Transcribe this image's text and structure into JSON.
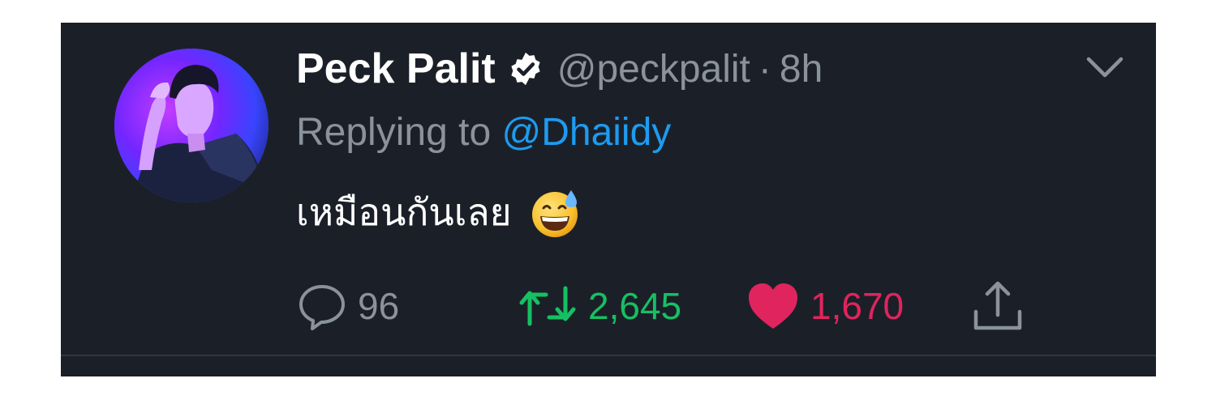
{
  "tweet": {
    "author": {
      "display_name": "Peck Palit",
      "handle": "@peckpalit",
      "verified": true,
      "avatar_icon": "profile-photo"
    },
    "separator": "·",
    "time": "8h",
    "reply": {
      "prefix": "Replying to",
      "mention": "@Dhaiidy"
    },
    "text": "เหมือนกันเลย",
    "emoji": "grinning-face-with-sweat",
    "actions": {
      "replies": "96",
      "retweets": "2,645",
      "likes": "1,670"
    }
  },
  "colors": {
    "background": "#1b2028",
    "text": "#ffffff",
    "muted": "#8a929c",
    "link": "#1d9bf0",
    "retweet": "#17bf63",
    "like": "#e0245e"
  }
}
